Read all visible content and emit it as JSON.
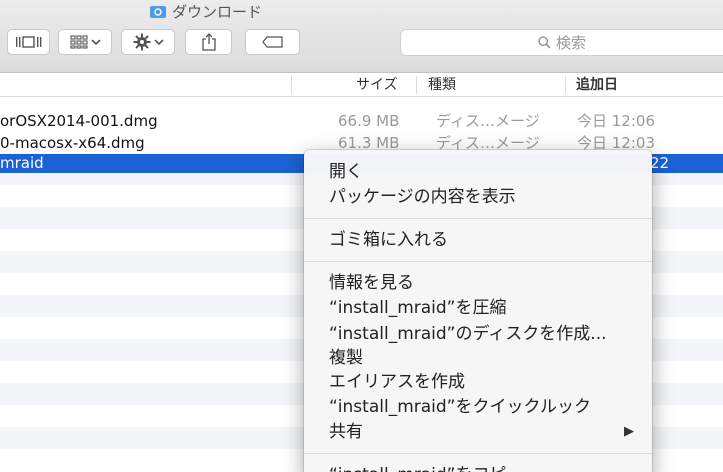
{
  "window": {
    "title": "ダウンロード"
  },
  "toolbar": {
    "view_label": "⊪◻⊪",
    "arrange_chevron": "⌄",
    "action_chevron": "⌄",
    "search_placeholder": "検索"
  },
  "columns": {
    "size": "サイズ",
    "kind": "種類",
    "added": "追加日"
  },
  "files": [
    {
      "name": "orOSX2014-001.dmg",
      "size": "66.9 MB",
      "kind": "ディス…メージ",
      "added": "今日 12:06"
    },
    {
      "name": "0-macosx-x64.dmg",
      "size": "61.3 MB",
      "kind": "ディス…メージ",
      "added": "今日 12:03"
    },
    {
      "name": "mraid",
      "size": "",
      "kind": "",
      "added": "22"
    }
  ],
  "context_menu": {
    "open": "開く",
    "show_package": "パッケージの内容を表示",
    "trash": "ゴミ箱に入れる",
    "get_info": "情報を見る",
    "compress": "“install_mraid”を圧縮",
    "burn": "“install_mraid”のディスクを作成...",
    "duplicate": "複製",
    "alias": "エイリアスを作成",
    "quicklook": "“install_mraid”をクイックルック",
    "share": "共有",
    "share_arrow": "▶",
    "partial": "“install_mraid”をコピー"
  },
  "colors": {
    "selection": "#1b62d6",
    "folder": "#4a9ee8"
  }
}
